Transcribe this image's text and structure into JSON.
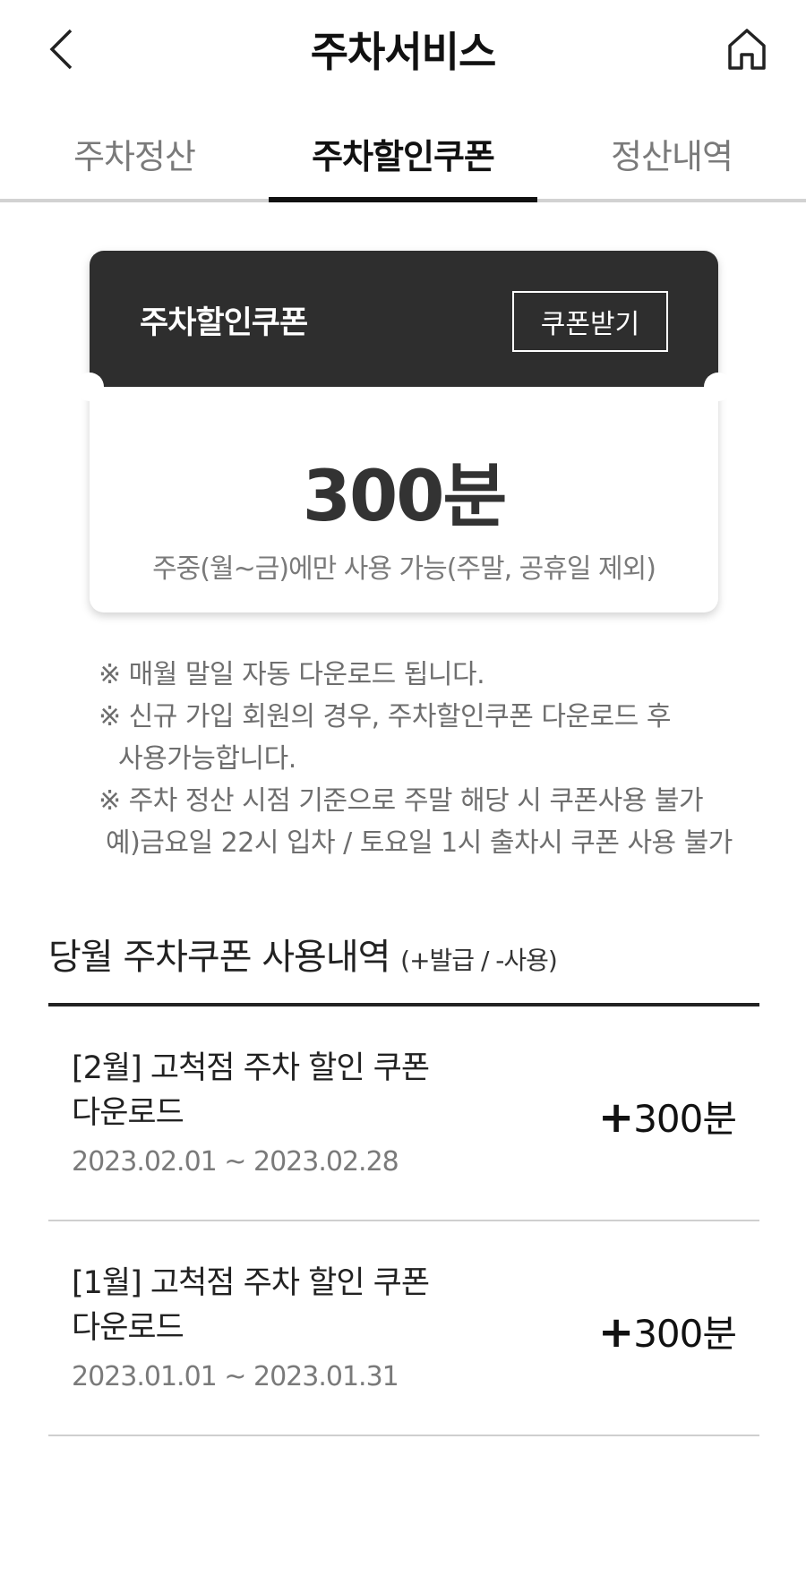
{
  "header": {
    "title": "주차서비스",
    "back_icon": "chevron-left-icon",
    "home_icon": "home-icon"
  },
  "tabs": [
    {
      "label": "주차정산",
      "active": false
    },
    {
      "label": "주차할인쿠폰",
      "active": true
    },
    {
      "label": "정산내역",
      "active": false
    }
  ],
  "coupon": {
    "title": "주차할인쿠폰",
    "button_label": "쿠폰받기",
    "amount": "300분",
    "note": "주중(월~금)에만 사용 가능(주말, 공휴일 제외)"
  },
  "notices": [
    "※ 매월 말일 자동 다운로드 됩니다.",
    "※ 신규 가입 회원의 경우, 주차할인쿠폰 다운로드 후",
    "사용가능합니다.",
    "※ 주차 정산 시점 기준으로 주말 해당 시 쿠폰사용 불가",
    "예)금요일 22시 입차 / 토요일 1시 출차시 쿠폰 사용 불가"
  ],
  "history": {
    "title": "당월 주차쿠폰 사용내역",
    "subtitle": "(+발급 / -사용)",
    "items": [
      {
        "title_line1": "[2월] 고척점 주차 할인 쿠폰",
        "title_line2": "다운로드",
        "period": "2023.02.01 ~ 2023.02.28",
        "sign": "+",
        "amount": "300분"
      },
      {
        "title_line1": "[1월] 고척점 주차 할인 쿠폰",
        "title_line2": "다운로드",
        "period": "2023.01.01 ~ 2023.01.31",
        "sign": "+",
        "amount": "300분"
      }
    ]
  },
  "colors": {
    "coupon_header_bg": "#2e2e2e",
    "active_tab": "#111111",
    "muted_text": "#7a7a7a"
  }
}
